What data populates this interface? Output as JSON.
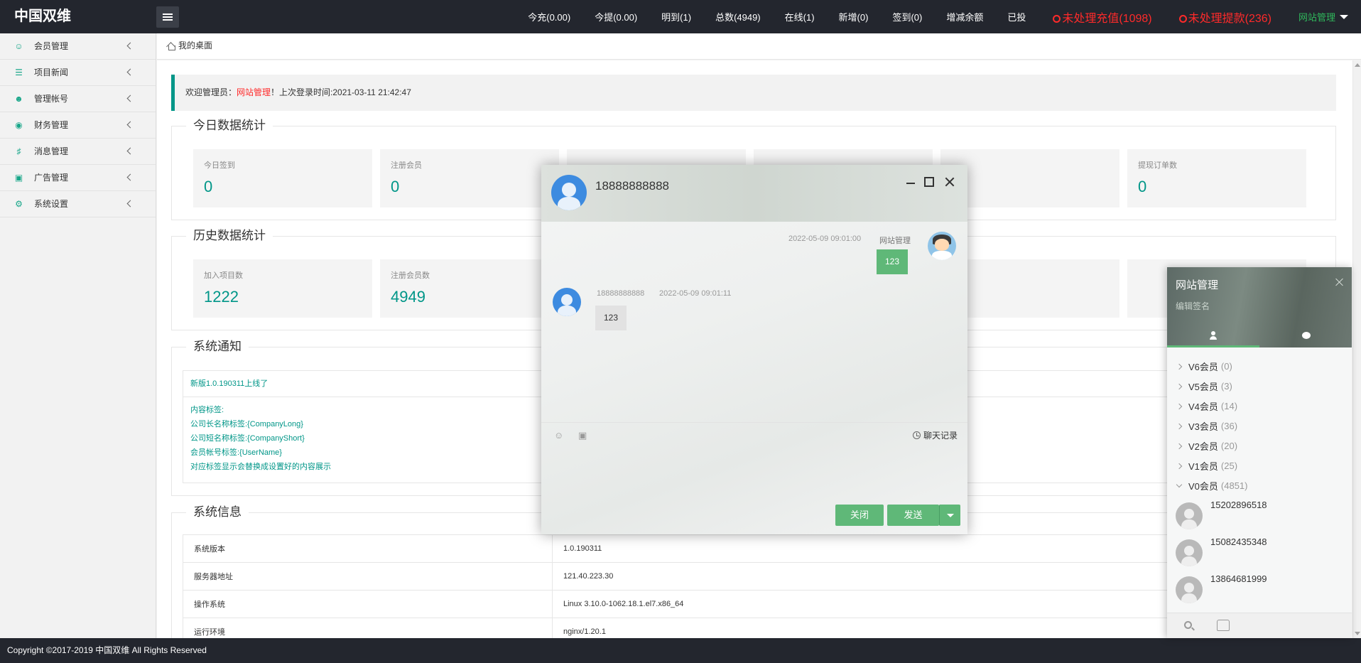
{
  "app": {
    "logo": "中国双维"
  },
  "topnav": [
    {
      "label": "今充(0.00)"
    },
    {
      "label": "今提(0.00)"
    },
    {
      "label": "明到(1)"
    },
    {
      "label": "总数(4949)"
    },
    {
      "label": "在线(1)"
    },
    {
      "label": "新增(0)"
    },
    {
      "label": "签到(0)"
    },
    {
      "label": "增减余额"
    },
    {
      "label": "已投"
    }
  ],
  "alerts": {
    "recharge": "未处理充值(1098)",
    "withdraw": "未处理提款(236)",
    "colors": {
      "alert": "#ff2a2a"
    }
  },
  "user_menu": {
    "label": "网站管理"
  },
  "sidebar": [
    {
      "label": "会员管理",
      "icon": "user-icon"
    },
    {
      "label": "项目新闻",
      "icon": "book-icon"
    },
    {
      "label": "管理帐号",
      "icon": "account-icon"
    },
    {
      "label": "财务管理",
      "icon": "finance-icon"
    },
    {
      "label": "消息管理",
      "icon": "speaker-icon"
    },
    {
      "label": "广告管理",
      "icon": "image-icon"
    },
    {
      "label": "系统设置",
      "icon": "gear-icon"
    }
  ],
  "tab": {
    "home": "我的桌面"
  },
  "welcome": {
    "prefix": "欢迎管理员：",
    "name": "网站管理",
    "suffix": "！上次登录时间:2021-03-11 21:42:47"
  },
  "today": {
    "title": "今日数据统计",
    "cards": [
      {
        "label": "今日签到",
        "value": "0"
      },
      {
        "label": "注册会员",
        "value": "0"
      },
      {
        "label": "",
        "value": ""
      },
      {
        "label": "",
        "value": ""
      },
      {
        "label": "",
        "value": ""
      },
      {
        "label": "提现订单数",
        "value": "0"
      }
    ]
  },
  "history": {
    "title": "历史数据统计",
    "cards": [
      {
        "label": "加入项目数",
        "value": "1222"
      },
      {
        "label": "注册会员数",
        "value": "4949"
      },
      {
        "label": "",
        "value": ""
      },
      {
        "label": "",
        "value": ""
      },
      {
        "label": "",
        "value": ""
      },
      {
        "label": "",
        "value": ""
      }
    ]
  },
  "notice": {
    "title": "系统通知",
    "headline": "新版1.0.190311上线了",
    "lines": [
      "内容标签:",
      "公司长名称标签:{CompanyLong}",
      "公司短名称标签:{CompanyShort}",
      "会员帐号标签:{UserName}",
      "对应标签显示会替换成设置好的内容展示"
    ]
  },
  "sysinfo": {
    "title": "系统信息",
    "rows": [
      {
        "key": "系统版本",
        "value": "1.0.190311"
      },
      {
        "key": "服务器地址",
        "value": "121.40.223.30"
      },
      {
        "key": "操作系统",
        "value": "Linux 3.10.0-1062.18.1.el7.x86_64"
      },
      {
        "key": "运行环境",
        "value": "nginx/1.20.1"
      }
    ]
  },
  "footer": {
    "text": "Copyright ©2017-2019 中国双维 All Rights Reserved"
  },
  "chat": {
    "title": "18888888888",
    "messages": [
      {
        "time": "2022-05-09 09:01:00",
        "sender": "网站管理",
        "text": "123",
        "mine": true
      },
      {
        "sender": "18888888888",
        "time": "2022-05-09 09:01:11",
        "text": "123",
        "mine": false
      }
    ],
    "history_label": "聊天记录",
    "close_label": "关闭",
    "send_label": "发送",
    "icons": [
      "smile-icon",
      "image-icon",
      "clock-icon"
    ]
  },
  "panel": {
    "title": "网站管理",
    "signature": "编辑签名",
    "groups": [
      {
        "name": "V6会员",
        "count": "(0)"
      },
      {
        "name": "V5会员",
        "count": "(3)"
      },
      {
        "name": "V4会员",
        "count": "(14)"
      },
      {
        "name": "V3会员",
        "count": "(36)"
      },
      {
        "name": "V2会员",
        "count": "(20)"
      },
      {
        "name": "V1会员",
        "count": "(25)"
      },
      {
        "name": "V0会员",
        "count": "(4851)"
      }
    ],
    "friends": [
      "15202896518",
      "15082435348",
      "13864681999"
    ]
  },
  "colors": {
    "accent": "#009688",
    "green": "#5fb878",
    "topbar": "#23262e"
  }
}
